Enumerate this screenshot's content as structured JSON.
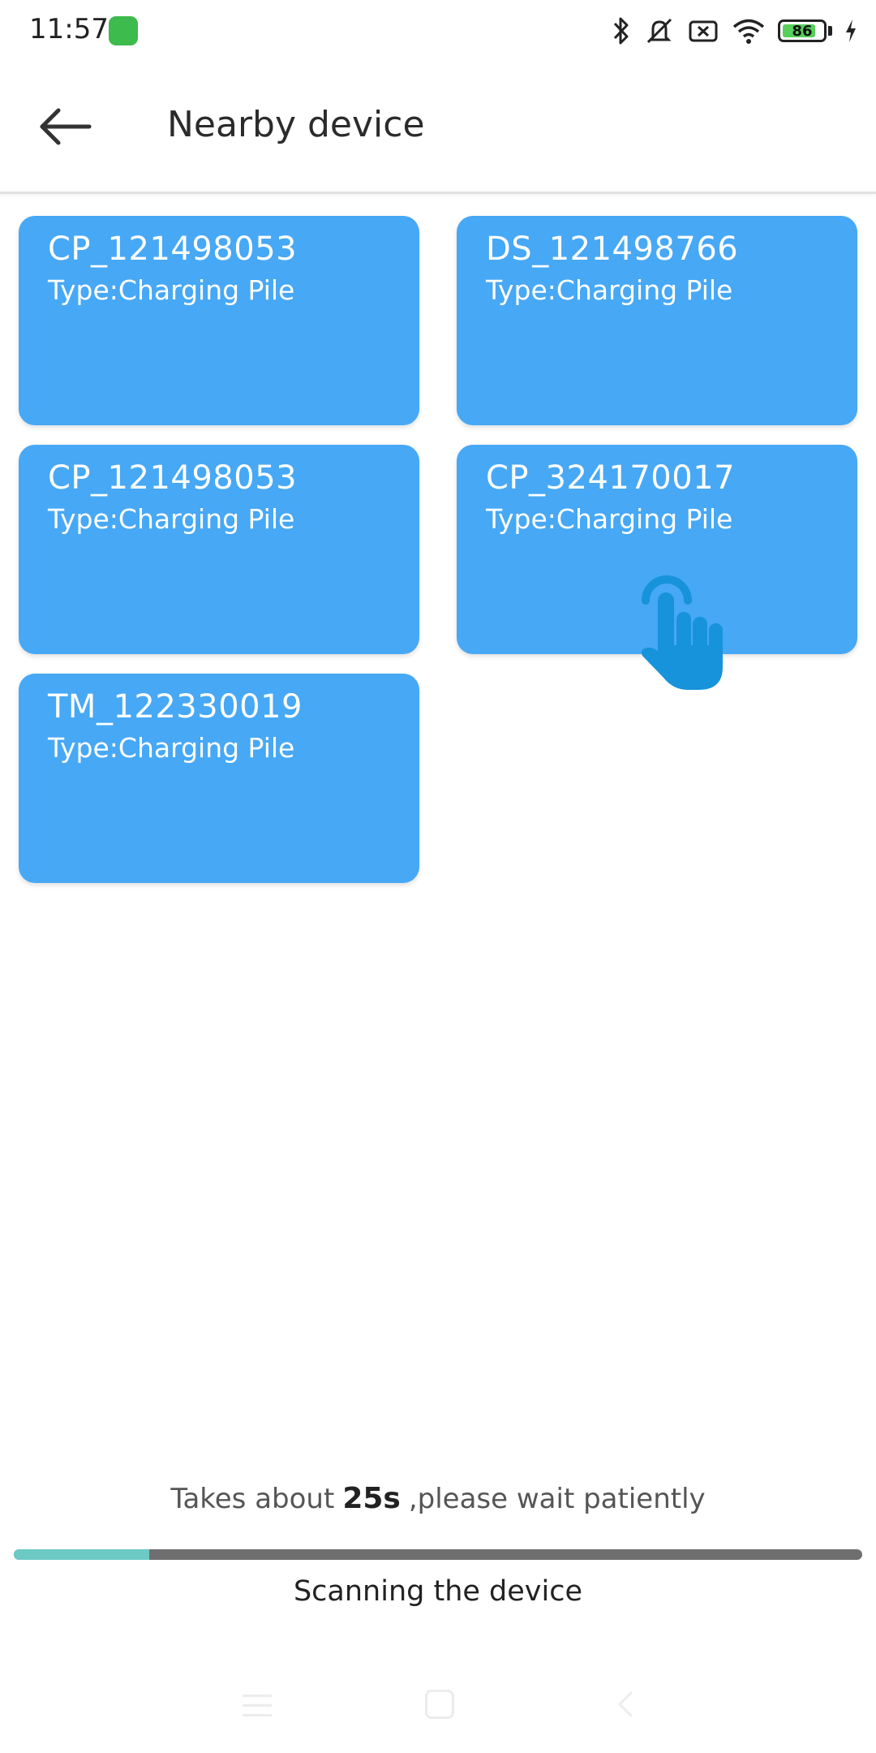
{
  "status_bar": {
    "time": "11:57",
    "battery_level": "86",
    "battery_fraction": 0.86
  },
  "header": {
    "title": "Nearby device"
  },
  "devices": [
    {
      "name": "CP_121498053",
      "type": "Type:Charging Pile"
    },
    {
      "name": "DS_121498766",
      "type": "Type:Charging Pile"
    },
    {
      "name": "CP_121498053",
      "type": "Type:Charging Pile"
    },
    {
      "name": "CP_324170017",
      "type": "Type:Charging Pile"
    },
    {
      "name": "TM_122330019",
      "type": "Type:Charging Pile"
    }
  ],
  "scan": {
    "hint_prefix": "Takes about",
    "seconds": "25s",
    "hint_suffix": ",please wait patiently",
    "progress": 0.16,
    "status_text": "Scanning the device"
  },
  "colors": {
    "card_bg": "#47a8f5",
    "progress_fill": "#6cc9c4",
    "progress_track": "#6f6f6f",
    "hand_icon": "#1693db"
  }
}
